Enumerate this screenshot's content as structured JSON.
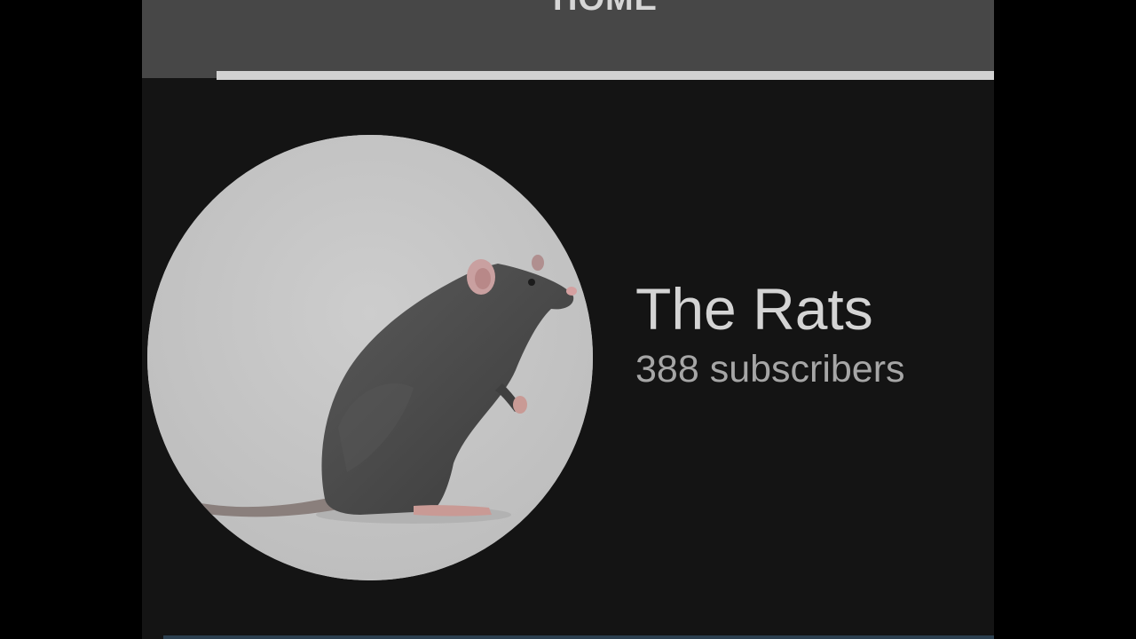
{
  "tabs": {
    "home_label": "HOME"
  },
  "channel": {
    "name": "The Rats",
    "subscribers": "388 subscribers",
    "avatar_icon": "rat-photo-icon"
  },
  "colors": {
    "background": "#141414",
    "tabbar": "#474747",
    "indicator": "#d2d2d2",
    "avatar_bg": "#c6c6c6",
    "rat_fur": "#4a4a4a"
  }
}
